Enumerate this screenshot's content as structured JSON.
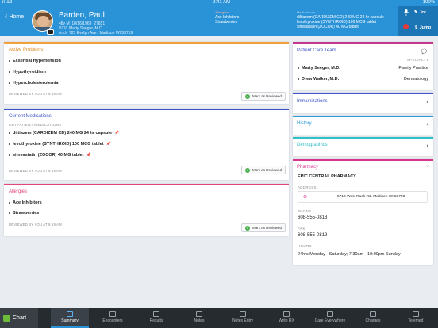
{
  "status_bar": {
    "device": "iPad",
    "time": "9:41 AM",
    "battery": "100%"
  },
  "header": {
    "home_label": "Home",
    "patient_name": "Barden, Paul",
    "age_sex": "48y M",
    "dob": "10/16/1969",
    "mrn": "27651",
    "pcp_label": "PCP",
    "pcp": "Marty Seeger, M.D.",
    "addr_label": "Addr",
    "address": "723 Evelyn Ave., Madison WI 53719",
    "allergies_label": "Allergies",
    "allergies": [
      "Ace Inhibitors",
      "Strawberries"
    ],
    "medications_label": "Medications",
    "medications": [
      "diltiazem (CARDIZEM CD) 240 MG 24 hr capsule",
      "levothyroxine (SYNTHROID) 100 MCG tablet",
      "simvastatin (ZOCOR) 40 MG tablet"
    ],
    "jot_label": "Jot",
    "jump_label": "Jump"
  },
  "problems": {
    "title": "Active Problems",
    "items": [
      "Essential Hypertension",
      "Hypothyroidism",
      "Hypercholesterolemia"
    ],
    "reviewed": "REVIEWED BY YOU AT 9:59 AM",
    "mark_label": "Mark as Reviewed"
  },
  "medications": {
    "title": "Current Medications",
    "subheading": "OUTPATIENT MEDICATIONS",
    "items": [
      "diltiazem (CARDIZEM CD) 240 MG 24 hr capsule",
      "levothyroxine (SYNTHROID) 100 MCG tablet",
      "simvastatin (ZOCOR) 40 MG tablet"
    ],
    "reviewed": "REVIEWED BY YOU AT 9:59 AM",
    "mark_label": "Mark as Reviewed"
  },
  "allergies": {
    "title": "Allergies",
    "items": [
      "Ace Inhibitors",
      "Strawberries"
    ],
    "reviewed": "REVIEWED BY YOU AT 9:59 AM",
    "mark_label": "Mark as Reviewed"
  },
  "care_team": {
    "title": "Patient Care Team",
    "specialty_label": "SPECIALTY",
    "members": [
      {
        "name": "Marty Seeger, M.D.",
        "specialty": "Family Practice"
      },
      {
        "name": "Drew Walker, M.D.",
        "specialty": "Dermatology"
      }
    ]
  },
  "sections": {
    "immunizations": "Immunizations",
    "history": "History",
    "demographics": "Demographics"
  },
  "pharmacy": {
    "title": "Pharmacy",
    "name": "EPIC CENTRAL PHARMACY",
    "address_label": "ADDRESS",
    "address": "5710 West Rock Rd. Madison WI 53708",
    "phone_label": "PHONE",
    "phone": "608-555-0818",
    "fax_label": "FAX",
    "fax": "608-555-0819",
    "hours_label": "HOURS",
    "hours": "24hrs Monday - Saturday; 7:30am - 10:00pm Sunday"
  },
  "tabs": {
    "chart": "Chart",
    "items": [
      "Summary",
      "Encounters",
      "Results",
      "Notes",
      "Notes Entry",
      "Write RX",
      "Care Everywhere",
      "Charges",
      "Telemed"
    ]
  },
  "colors": {
    "header": "#2a93d8",
    "problems": "#f0a13a",
    "medications": "#3d55c8",
    "allergies": "#e2457a",
    "care_team": "#c03a8e",
    "immunizations": "#3d55c8",
    "history": "#2f9bd6",
    "demographics": "#2fc0c8",
    "pharmacy": "#d8358f"
  }
}
